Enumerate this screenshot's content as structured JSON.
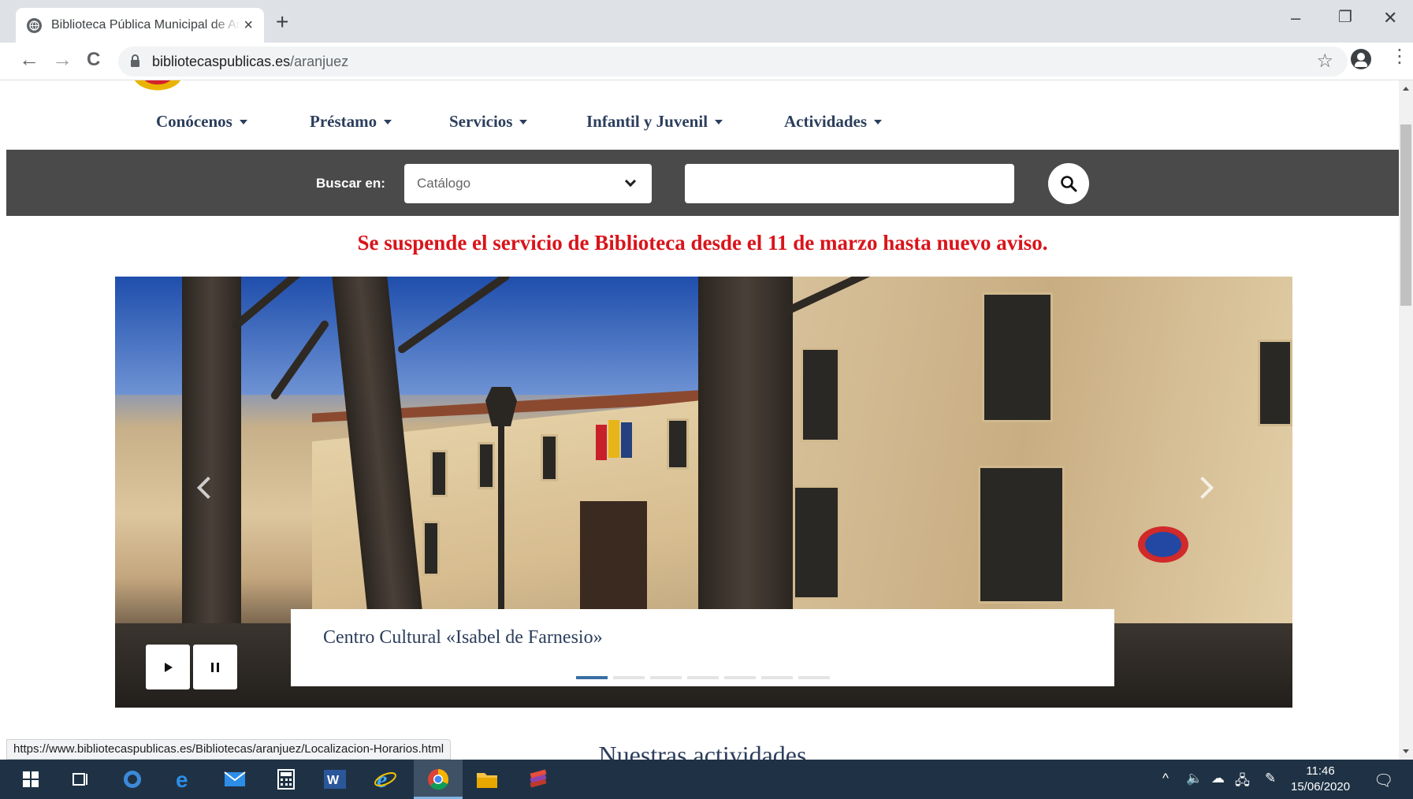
{
  "browser": {
    "tab_title": "Biblioteca Pública Municipal de Aranjuez",
    "tab_close": "×",
    "new_tab": "+",
    "url_host": "bibliotecaspublicas.es",
    "url_path": "/aranjuez",
    "win_min": "–",
    "win_restore": "❐",
    "win_close": "✕",
    "back": "←",
    "forward": "→",
    "reload": "C",
    "star": "☆",
    "menu": "⋮"
  },
  "nav": {
    "items": [
      {
        "label": "Conócenos"
      },
      {
        "label": "Préstamo"
      },
      {
        "label": "Servicios"
      },
      {
        "label": "Infantil y Juvenil"
      },
      {
        "label": "Actividades"
      }
    ]
  },
  "search": {
    "label": "Buscar en:",
    "selected": "Catálogo",
    "query": ""
  },
  "notice": "Se suspende el servicio de Biblioteca desde el 11 de marzo hasta nuevo aviso.",
  "carousel": {
    "caption": "Centro Cultural «Isabel de Farnesio»",
    "slide_count": 7,
    "active_index": 0
  },
  "section_heading": "Nuestras actividades",
  "status_url": "https://www.bibliotecaspublicas.es/Bibliotecas/aranjuez/Localizacion-Horarios.html",
  "taskbar": {
    "time": "11:46",
    "date": "15/06/2020"
  },
  "colors": {
    "nav_text": "#2c3e5c",
    "notice": "#d9141b",
    "search_band": "#4a4a4a",
    "taskbar": "#1f3245"
  }
}
